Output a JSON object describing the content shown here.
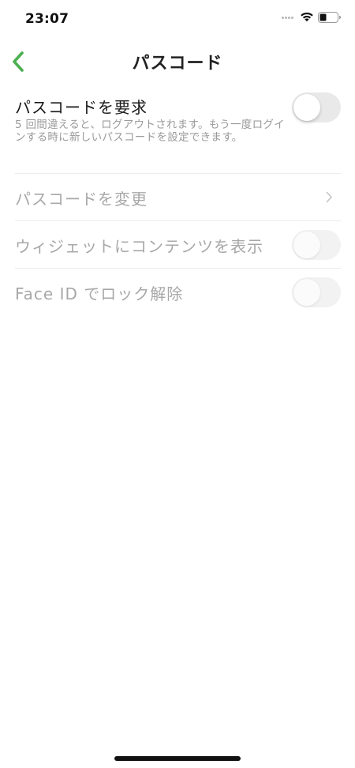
{
  "status_bar": {
    "time": "23:07"
  },
  "nav": {
    "title": "パスコード",
    "back_icon": "chevron-left-icon",
    "accent_color": "#4caf50"
  },
  "settings": {
    "require_passcode": {
      "title": "パスコードを要求",
      "description": "5 回間違えると、ログアウトされます。もう一度ログインする時に新しいパスコードを設定できます。",
      "enabled": false
    },
    "change_passcode": {
      "title": "パスコードを変更",
      "disabled": true
    },
    "widget_content": {
      "title": "ウィジェットにコンテンツを表示",
      "enabled": false,
      "disabled": true
    },
    "face_id_unlock": {
      "title": "Face ID でロック解除",
      "enabled": false,
      "disabled": true
    }
  }
}
